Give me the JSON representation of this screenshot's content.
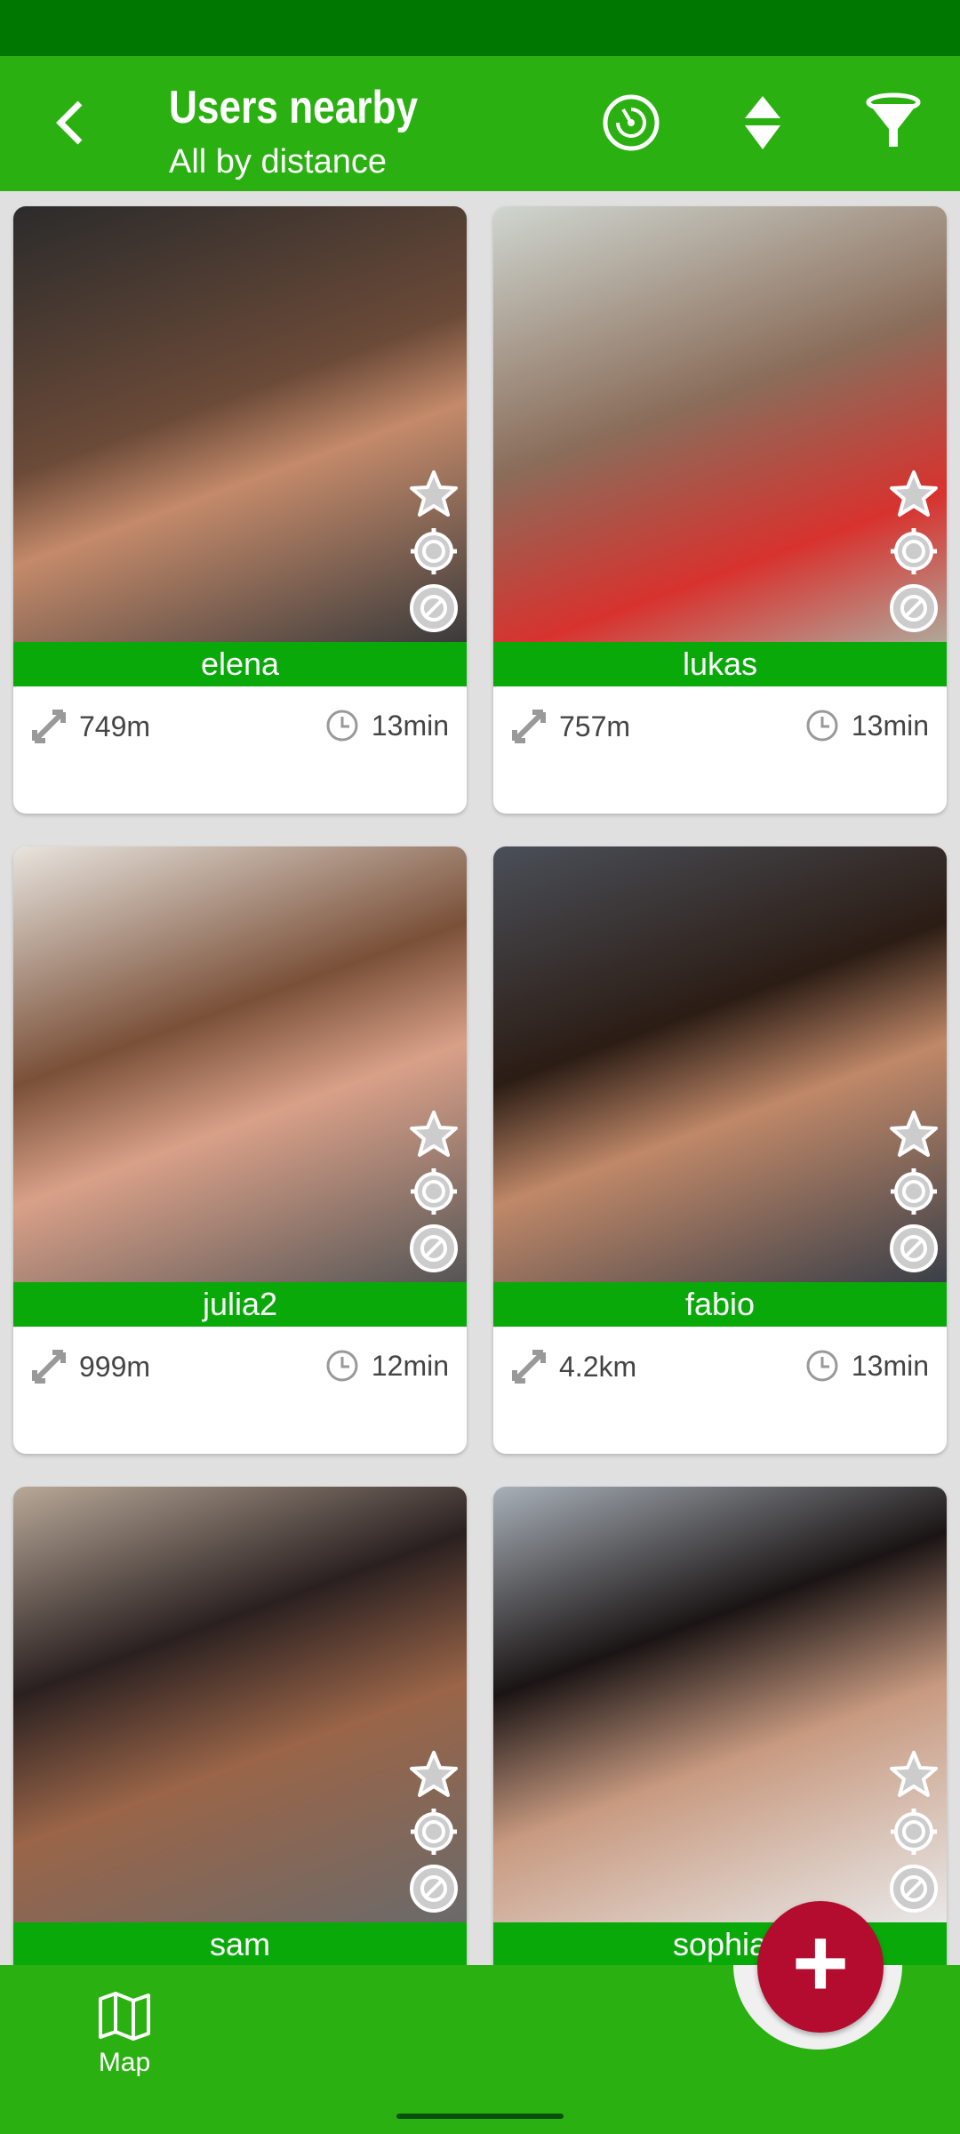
{
  "header": {
    "title": "Users nearby",
    "subtitle": "All by distance",
    "icons": [
      "back-chevron-icon",
      "radar-icon",
      "sort-icon",
      "filter-icon"
    ]
  },
  "colors": {
    "status_bar": "#007800",
    "header": "#2ab010",
    "name_bar": "#0aa90a",
    "fab": "#b30c2e",
    "background": "#e0e0e0"
  },
  "users": [
    {
      "name": "elena",
      "distance": "749m",
      "time": "13min"
    },
    {
      "name": "lukas",
      "distance": "757m",
      "time": "13min"
    },
    {
      "name": "julia2",
      "distance": "999m",
      "time": "12min"
    },
    {
      "name": "fabio",
      "distance": "4.2km",
      "time": "13min"
    },
    {
      "name": "sam",
      "distance": "",
      "time": ""
    },
    {
      "name": "sophia",
      "distance": "",
      "time": ""
    }
  ],
  "bottom_nav": {
    "map_label": "Map"
  },
  "fab": {
    "label": "+"
  }
}
